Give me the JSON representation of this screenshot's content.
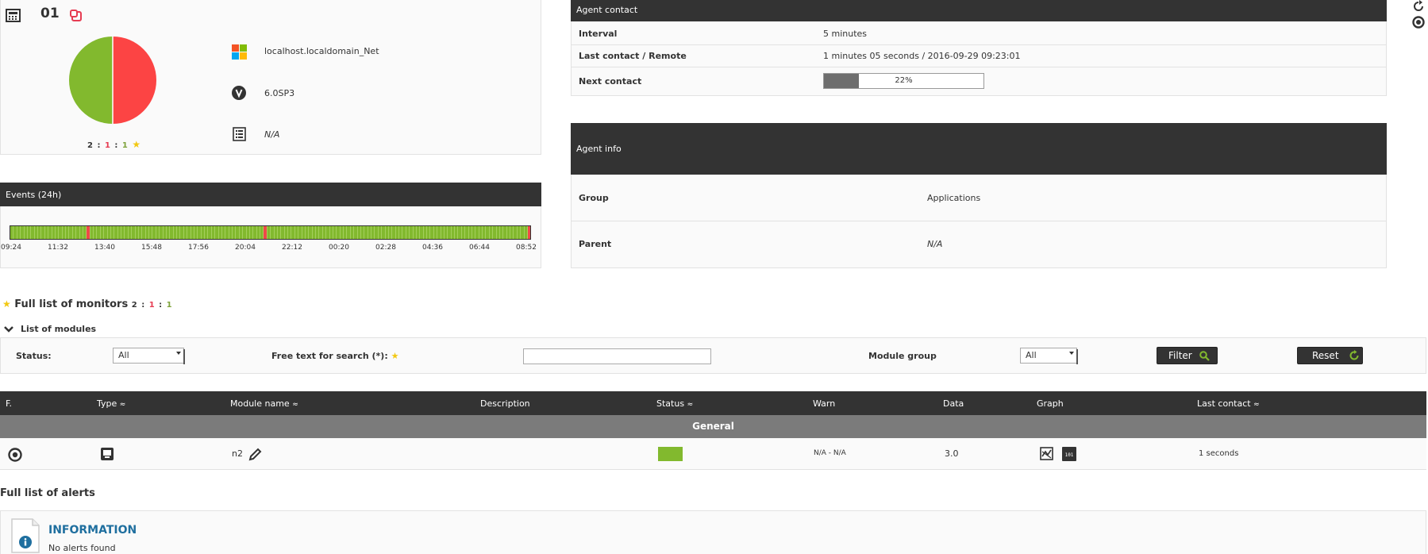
{
  "agent": {
    "name": "01",
    "os_name": "localhost.localdomain_Net",
    "version": "6.0SP3",
    "description": "N/A",
    "monitor_counts": {
      "normal": "2",
      "critical": "1",
      "warning": "1",
      "sep": ":"
    }
  },
  "status_pie": {
    "slices": [
      {
        "label": "critical",
        "value": 50,
        "color": "#fc4444"
      },
      {
        "label": "normal",
        "value": 50,
        "color": "#82b92e"
      }
    ]
  },
  "agent_contact": {
    "title": "Agent contact",
    "rows": [
      {
        "label": "Interval",
        "value": "5 minutes"
      },
      {
        "label": "Last contact / Remote",
        "value": "1 minutes 05 seconds / 2016-09-29 09:23:01"
      },
      {
        "label": "Next contact",
        "progress_text": "22%",
        "progress": 0.22
      }
    ]
  },
  "agent_info": {
    "title": "Agent info",
    "rows": [
      {
        "label": "Group",
        "value": "Applications"
      },
      {
        "label": "Parent",
        "value": "N/A"
      }
    ]
  },
  "events": {
    "title": "Events (24h)",
    "ticks": [
      "09:24",
      "11:32",
      "13:40",
      "15:48",
      "17:56",
      "20:04",
      "22:12",
      "00:20",
      "02:28",
      "04:36",
      "06:44",
      "08:52"
    ],
    "segments": [
      "ok",
      "ok",
      "ok",
      "ok",
      "ok",
      "ok",
      "ok",
      "ok",
      "ok",
      "ok",
      "ok",
      "ok",
      "ok",
      "ok",
      "ok",
      "ok",
      "ok",
      "ok",
      "ok",
      "ok",
      "ok",
      "ok",
      "ok",
      "ok",
      "ok",
      "ok",
      "ok",
      "ok",
      "ok",
      "ok",
      "ok",
      "ok",
      "ok",
      "ok",
      "ok",
      "ok",
      "ok",
      "ok",
      "ok",
      "ok",
      "ok",
      "ok",
      "ok",
      "ok",
      "ok",
      "ok",
      "ok",
      "ok",
      "ok",
      "ok",
      "ok",
      "ok",
      "ok",
      "ok",
      "ok",
      "ok",
      "ok",
      "ok",
      "ok",
      "ok",
      "ok",
      "ok",
      "ok",
      "ok",
      "ok",
      "ok",
      "ok",
      "ok",
      "ok",
      "ok",
      "ok",
      "ok",
      "ok",
      "ok",
      "ok",
      "ok",
      "ok",
      "ok",
      "ok",
      "ok",
      "ok",
      "ok",
      "ok",
      "ok",
      "ok",
      "ok",
      "ok",
      "ok",
      "ok",
      "ok",
      "ok",
      "ok",
      "ok",
      "ok",
      "ok",
      "ok",
      "ok",
      "ok",
      "ok",
      "ok",
      "ok",
      "ok",
      "ok",
      "ok",
      "ok",
      "ok",
      "ok",
      "ok",
      "ok",
      "ok",
      "ok",
      "ok",
      "ok",
      "ok",
      "ok",
      "ok",
      "ok",
      "ok",
      "ok",
      "ok",
      "ok",
      "ok",
      "ok",
      "ok",
      "ok",
      "ok",
      "ok",
      "ok",
      "ok",
      "ok",
      "ok",
      "ok",
      "ok",
      "ok",
      "ok",
      "ok",
      "ok",
      "ok",
      "ok",
      "ok",
      "ok",
      "ok",
      "ok",
      "ok",
      "ok",
      "ok",
      "ok",
      "ok",
      "ok",
      "ok"
    ]
  },
  "monitors": {
    "title": "Full list of monitors",
    "counts": {
      "normal": "2",
      "critical": "1",
      "warning": "1",
      "sep": ":"
    },
    "modules_toggle": "List of modules"
  },
  "filter": {
    "status_label": "Status:",
    "status_value": "All",
    "search_label": "Free text for search (*):",
    "search_value": "",
    "group_label": "Module group",
    "group_value": "All",
    "filter_button": "Filter",
    "reset_button": "Reset"
  },
  "modules_table": {
    "headers": {
      "f": "F.",
      "type": "Type",
      "name": "Module name",
      "description": "Description",
      "status": "Status",
      "warn": "Warn",
      "data": "Data",
      "graph": "Graph",
      "last_contact": "Last contact"
    },
    "group": "General",
    "rows": [
      {
        "name": "n2",
        "description": "",
        "status_color": "#82b92e",
        "warn": "N/A - N/A",
        "data": "3.0",
        "last_contact": "1 seconds"
      }
    ]
  },
  "alerts": {
    "title": "Full list of alerts",
    "info_title": "INFORMATION",
    "info_text": "No alerts found"
  },
  "colors": {
    "dark_header": "#333333",
    "ok": "#82b92e",
    "critical": "#fc4444",
    "warning_star": "#f2c811",
    "info_blue": "#1f6f9f"
  }
}
